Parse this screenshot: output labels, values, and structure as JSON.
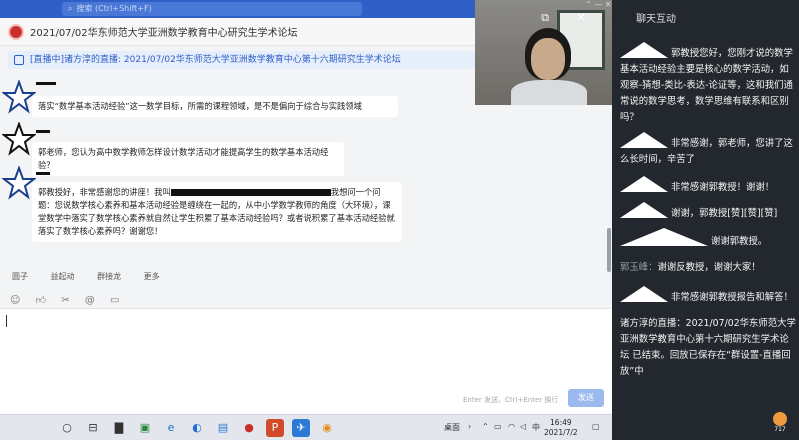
{
  "search": {
    "placeholder": "搜索 (Ctrl+Shift+F)"
  },
  "header": {
    "title": "2021/07/02华东师范大学亚洲数学教育中心研究生学术论坛"
  },
  "live_banner": "[直播中]诸方淳的直播: 2021/07/02华东师范大学亚洲数学教育中心第十六期研究生学术论坛",
  "messages": [
    {
      "text": "落实“数学基本活动经验”这一数学目标，所需的课程领域，是不是偏向于综合与实践领域"
    },
    {
      "text": "郭老师，您认为高中数学教师怎样设计数学活动才能提高学生的数学基本活动经验？"
    },
    {
      "text_a": "郭教授好，非常感谢您的讲座！我叫",
      "text_b": "我想问一个问题：您说数学核心素养和基本活动经验是缠绕在一起的，从中小学数学教师的角度（大环境），课堂数学中落实了数学核心素养就自然让学生积累了基本活动经验吗？或者说积累了基本活动经验就落实了数学核心素养吗？谢谢您！"
    }
  ],
  "toolbar1": [
    "圆子",
    "益起动",
    "群接龙",
    "更多"
  ],
  "toolbar2_icons": [
    "emoji-icon",
    "like-icon",
    "scissors-icon",
    "at-icon",
    "screen-icon"
  ],
  "input": {
    "hint": "Enter 发送，Ctrl+Enter 换行",
    "send": "发送"
  },
  "right_panel": {
    "title": "聊天互动",
    "messages": [
      {
        "name": "",
        "text": "郭教授您好，您刚才说的数学基本活动经验主要是核心的数学活动，如观察-猜想-类比-表达-论证等，这和我们通常说的数学思考，数学思维有联系和区别吗？"
      },
      {
        "name": "",
        "text": "非常感谢，郭老师，您讲了这么长时间，辛苦了"
      },
      {
        "name": "",
        "text": "非常感谢郭教授！谢谢！"
      },
      {
        "name": "",
        "text": "谢谢，郭教授[赞][赞][赞]"
      },
      {
        "name": "",
        "text": "谢谢郭教授。"
      },
      {
        "name": "郭玉峰：",
        "text": "谢谢反教授，谢谢大家！"
      },
      {
        "name": "",
        "text": "非常感谢郭教授报告和解答！"
      },
      {
        "name": "诸方淳的直播：",
        "text": "2021/07/02华东师范大学亚洲数学教育中心第十六期研究生学术论坛 已结束。回放已保存在“群设置-直播回放”中"
      }
    ],
    "likes": "717"
  },
  "taskbar": {
    "tray_text": "桌面",
    "ime": "中",
    "time": "16:49",
    "date": "2021/7/2"
  },
  "colors": {
    "accent": "#2f5fc7",
    "panel": "#23272e"
  }
}
